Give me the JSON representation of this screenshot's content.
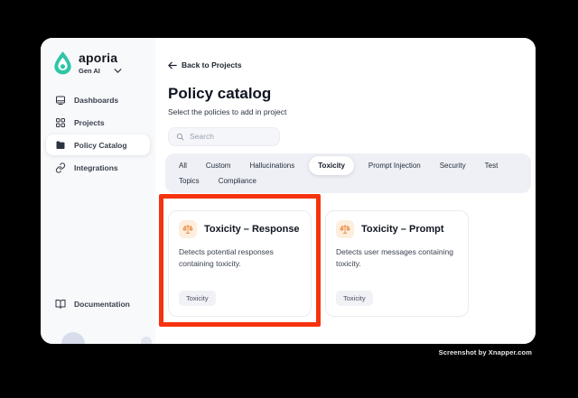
{
  "colors": {
    "red_highlight": "#f5330e",
    "brand_teal": "#2fc6a6",
    "card_icon_orange": "#ec8a3f",
    "card_icon_bg": "#fdeedd"
  },
  "sidebar": {
    "brand": {
      "name": "aporia",
      "workspace": "Gen AI"
    },
    "items": [
      {
        "label": "Dashboards"
      },
      {
        "label": "Projects"
      },
      {
        "label": "Policy Catalog"
      },
      {
        "label": "Integrations"
      }
    ],
    "active_item": "Policy Catalog",
    "footer_item": {
      "label": "Documentation"
    }
  },
  "main": {
    "back_link": "Back to Projects",
    "title": "Policy catalog",
    "subtitle": "Select the policies to add in project",
    "search": {
      "placeholder": "Search",
      "value": ""
    },
    "tabs": [
      "All",
      "Custom",
      "Hallucinations",
      "Toxicity",
      "Prompt Injection",
      "Security",
      "Test",
      "Topics",
      "Compliance"
    ],
    "active_tab": "Toxicity",
    "cards": [
      {
        "title": "Toxicity – Response",
        "description": "Detects potential responses containing toxicity.",
        "tag": "Toxicity",
        "highlighted": true
      },
      {
        "title": "Toxicity – Prompt",
        "description": "Detects user messages containing toxicity.",
        "tag": "Toxicity",
        "highlighted": false
      }
    ]
  },
  "watermark": "Screenshot by Xnapper.com"
}
